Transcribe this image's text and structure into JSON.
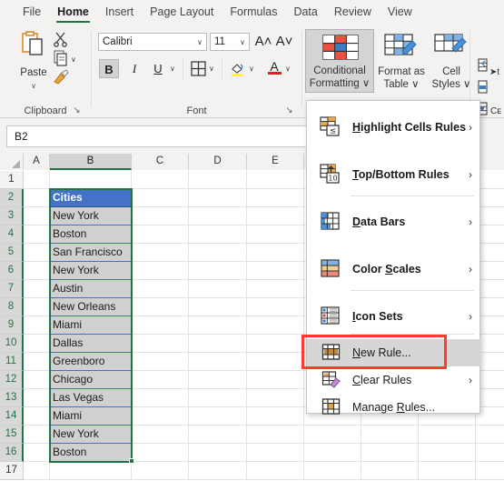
{
  "app": {
    "accent_green": "#217346",
    "active_cell_fill": "#4472C4",
    "range_fill": "#D0D0D0",
    "annotation_color": "#FF3B30"
  },
  "ribbon_tabs": [
    {
      "label": "File",
      "active": false
    },
    {
      "label": "Home",
      "active": true
    },
    {
      "label": "Insert",
      "active": false
    },
    {
      "label": "Page Layout",
      "active": false
    },
    {
      "label": "Formulas",
      "active": false
    },
    {
      "label": "Data",
      "active": false
    },
    {
      "label": "Review",
      "active": false
    },
    {
      "label": "View",
      "active": false
    }
  ],
  "ribbon": {
    "clipboard": {
      "group_label": "Clipboard",
      "paste_label": "Paste",
      "paste_caret": "∨",
      "cut_icon": "scissors-icon",
      "copy_icon": "copy-icon",
      "format_painter_icon": "format-painter-icon",
      "dialog_launcher": "↘"
    },
    "font": {
      "group_label": "Font",
      "font_name": "Calibri",
      "font_size": "11",
      "grow_font": "A˄",
      "shrink_font": "A˅",
      "bold": "B",
      "italic": "I",
      "underline": "U",
      "borders_icon": "borders-icon",
      "fill_color_icon": "fill-color-icon",
      "font_color": "A",
      "caret": "∨",
      "dialog_launcher": "↘"
    },
    "styles": {
      "conditional_formatting": {
        "line1": "Conditional",
        "line2": "Formatting ∨",
        "selected": true
      },
      "format_as_table": {
        "line1": "Format as",
        "line2": "Table ∨"
      },
      "cell_styles": {
        "line1": "Cell",
        "line2": "Styles ∨"
      }
    },
    "cells_partial": {
      "text1": "➤t",
      "text2": "Cᴇ"
    }
  },
  "formula_bar": {
    "name_box_value": "B2"
  },
  "grid": {
    "columns": [
      "A",
      "B",
      "C",
      "D",
      "E"
    ],
    "highlighted_column": "B",
    "rows": [
      "1",
      "2",
      "3",
      "4",
      "5",
      "6",
      "7",
      "8",
      "9",
      "10",
      "11",
      "12",
      "13",
      "14",
      "15",
      "16",
      "17"
    ],
    "selected_rows": [
      "2",
      "3",
      "4",
      "5",
      "6",
      "7",
      "8",
      "9",
      "10",
      "11",
      "12",
      "13",
      "14",
      "15",
      "16"
    ],
    "column_b_values": [
      {
        "row": "2",
        "value": "Cities",
        "active": true
      },
      {
        "row": "3",
        "value": "New York",
        "active": false
      },
      {
        "row": "4",
        "value": "Boston",
        "active": false
      },
      {
        "row": "5",
        "value": "San Francisco",
        "active": false
      },
      {
        "row": "6",
        "value": "New York",
        "active": false
      },
      {
        "row": "7",
        "value": "Austin",
        "active": false
      },
      {
        "row": "8",
        "value": "New Orleans",
        "active": false
      },
      {
        "row": "9",
        "value": "Miami",
        "active": false
      },
      {
        "row": "10",
        "value": "Dallas",
        "active": false
      },
      {
        "row": "11",
        "value": "Greenboro",
        "active": false
      },
      {
        "row": "12",
        "value": "Chicago",
        "active": false
      },
      {
        "row": "13",
        "value": "Las Vegas",
        "active": false
      },
      {
        "row": "14",
        "value": "Miami",
        "active": false
      },
      {
        "row": "15",
        "value": "New York",
        "active": false
      },
      {
        "row": "16",
        "value": "Boston",
        "active": false
      }
    ]
  },
  "menu": {
    "items": [
      {
        "label": "Highlight Cells Rules",
        "mnemonic": "H",
        "submenu": true,
        "icon": "highlight-cells-rules-icon",
        "highlighted": false
      },
      {
        "label": "Top/Bottom Rules",
        "mnemonic": "T",
        "submenu": true,
        "icon": "top-bottom-rules-icon",
        "highlighted": false
      },
      {
        "label": "Data Bars",
        "mnemonic": "D",
        "submenu": true,
        "icon": "data-bars-icon",
        "highlighted": false
      },
      {
        "label": "Color Scales",
        "mnemonic": "S",
        "submenu": true,
        "icon": "color-scales-icon",
        "highlighted": false
      },
      {
        "label": "Icon Sets",
        "mnemonic": "I",
        "submenu": true,
        "icon": "icon-sets-icon",
        "highlighted": false
      },
      {
        "label": "New Rule...",
        "mnemonic": "N",
        "submenu": false,
        "icon": "new-rule-icon",
        "highlighted": true
      },
      {
        "label": "Clear Rules",
        "mnemonic": "C",
        "submenu": true,
        "icon": "clear-rules-icon",
        "highlighted": false
      },
      {
        "label": "Manage Rules...",
        "mnemonic": "R",
        "submenu": false,
        "icon": "manage-rules-icon",
        "highlighted": false
      }
    ],
    "submenu_arrow": "›"
  }
}
